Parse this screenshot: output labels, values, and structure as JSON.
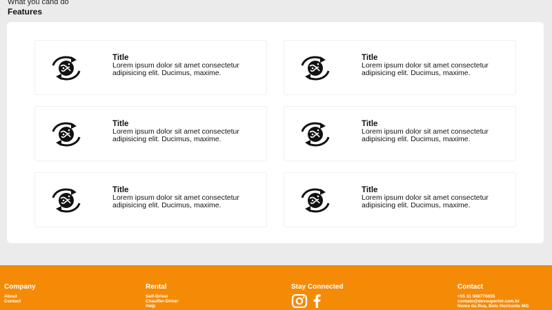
{
  "header": {
    "subtitle": "What you cand do",
    "title": "Features"
  },
  "features": [
    {
      "icon": "globe-cycle-icon",
      "title": "Title",
      "body": "Lorem ipsum dolor sit amet consectetur adipisicing elit. Ducimus, maxime."
    },
    {
      "icon": "globe-cycle-icon",
      "title": "Title",
      "body": "Lorem ipsum dolor sit amet consectetur adipisicing elit. Ducimus, maxime."
    },
    {
      "icon": "globe-cycle-icon",
      "title": "Title",
      "body": "Lorem ipsum dolor sit amet consectetur adipisicing elit. Ducimus, maxime."
    },
    {
      "icon": "globe-cycle-icon",
      "title": "Title",
      "body": "Lorem ipsum dolor sit amet consectetur adipisicing elit. Ducimus, maxime."
    },
    {
      "icon": "globe-cycle-icon",
      "title": "Title",
      "body": "Lorem ipsum dolor sit amet consectetur adipisicing elit. Ducimus, maxime."
    },
    {
      "icon": "globe-cycle-icon",
      "title": "Title",
      "body": "Lorem ipsum dolor sit amet consectetur adipisicing elit. Ducimus, maxime."
    }
  ],
  "footer": {
    "background": "#f58a07",
    "company": {
      "heading": "Company",
      "links": [
        "About",
        "Contact"
      ]
    },
    "rental": {
      "heading": "Rental",
      "links": [
        "Self-Driver",
        "Chauffer-Driver",
        "Help"
      ]
    },
    "social": {
      "heading": "Stay Connected",
      "icons": [
        "instagram-icon",
        "facebook-icon"
      ]
    },
    "contact": {
      "heading": "Contact",
      "lines": [
        "+55 31 988776655",
        "contato@devsuperior.com.br",
        "Nome da Rua, Belo Horizonte MG"
      ]
    }
  }
}
